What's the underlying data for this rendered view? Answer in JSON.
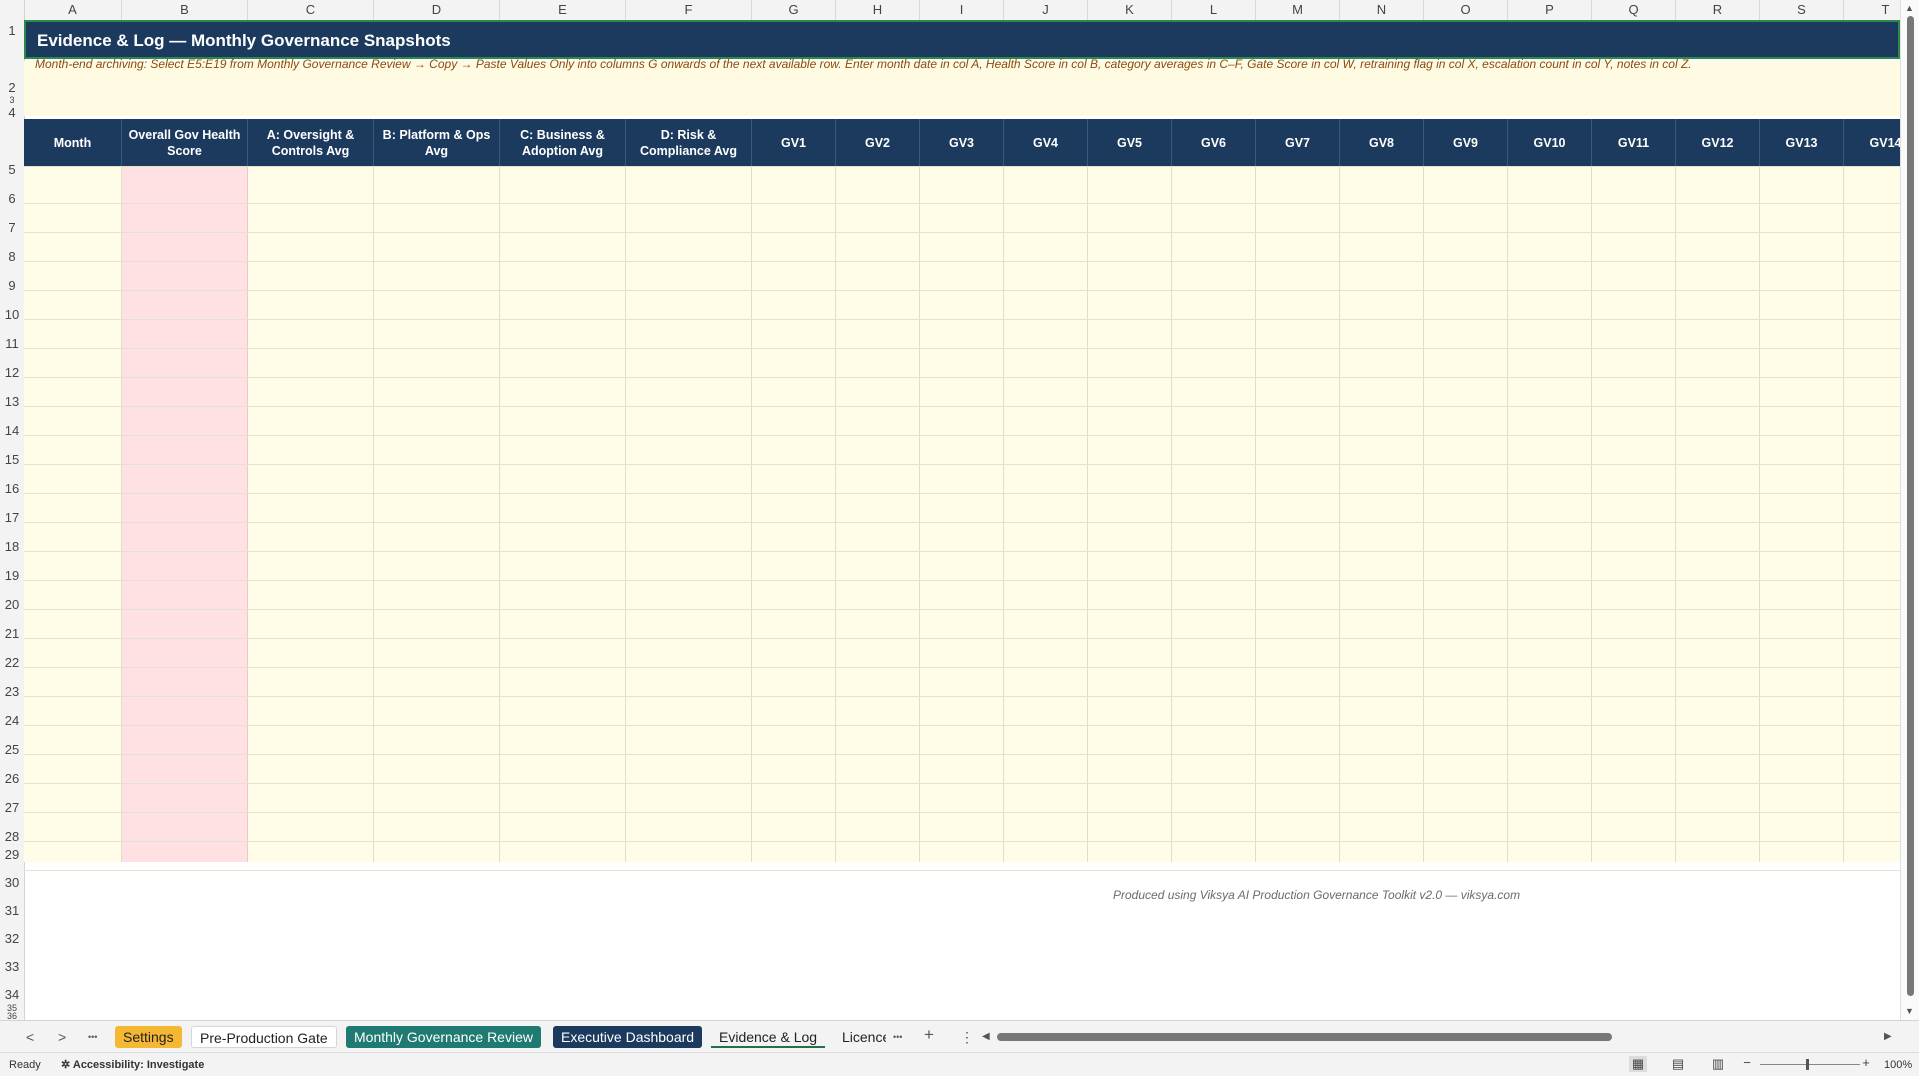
{
  "columns": [
    "A",
    "B",
    "C",
    "D",
    "E",
    "F",
    "G",
    "H",
    "I",
    "J",
    "K",
    "L",
    "M",
    "N",
    "O",
    "P",
    "Q",
    "R",
    "S",
    "T"
  ],
  "rows": [
    "1",
    "2",
    "3",
    "4",
    "5",
    "6",
    "7",
    "8",
    "9",
    "10",
    "11",
    "12",
    "13",
    "14",
    "15",
    "16",
    "17",
    "18",
    "19",
    "20",
    "21",
    "22",
    "23",
    "24",
    "25",
    "26",
    "27",
    "28",
    "29",
    "30",
    "31",
    "32",
    "33",
    "34",
    "35",
    "36"
  ],
  "sheet": {
    "title": "Evidence & Log — Monthly Governance Snapshots",
    "note": "Month-end archiving: Select E5:E19 from Monthly Governance Review → Copy → Paste Values Only into columns G onwards of the next available row. Enter month date in col A, Health Score in col B, category averages in C–F, Gate Score in col W, retraining flag in col X, escalation count in col Y, notes in col Z.",
    "headers": [
      "Month",
      "Overall Gov Health Score",
      "A: Oversight & Controls Avg",
      "B: Platform & Ops Avg",
      "C: Business & Adoption Avg",
      "D: Risk & Compliance Avg",
      "GV1",
      "GV2",
      "GV3",
      "GV4",
      "GV5",
      "GV6",
      "GV7",
      "GV8",
      "GV9",
      "GV10",
      "GV11",
      "GV12",
      "GV13",
      "GV14"
    ],
    "footer": "Produced using Viksya AI Production Governance Toolkit v2.0 — viksya.com",
    "colors": {
      "header_bg": "#1c3a5e",
      "input_fill": "#fffce8",
      "score_fill": "#ffe0e3",
      "note_text": "#8a4b10"
    }
  },
  "tabs": {
    "settings": "Settings",
    "pre_production": "Pre-Production Gate",
    "monthly": "Monthly Governance Review",
    "executive": "Executive Dashboard",
    "evidence": "Evidence & Log",
    "licence": "Licence",
    "more": "•••",
    "add": "+",
    "options": "⋮",
    "nav_prev": "<",
    "nav_next": ">",
    "nav_more": "•••"
  },
  "status": {
    "ready": "Ready",
    "accessibility": "Accessibility: Investigate",
    "zoom": "100%",
    "zoom_minus": "−",
    "zoom_plus": "+"
  }
}
